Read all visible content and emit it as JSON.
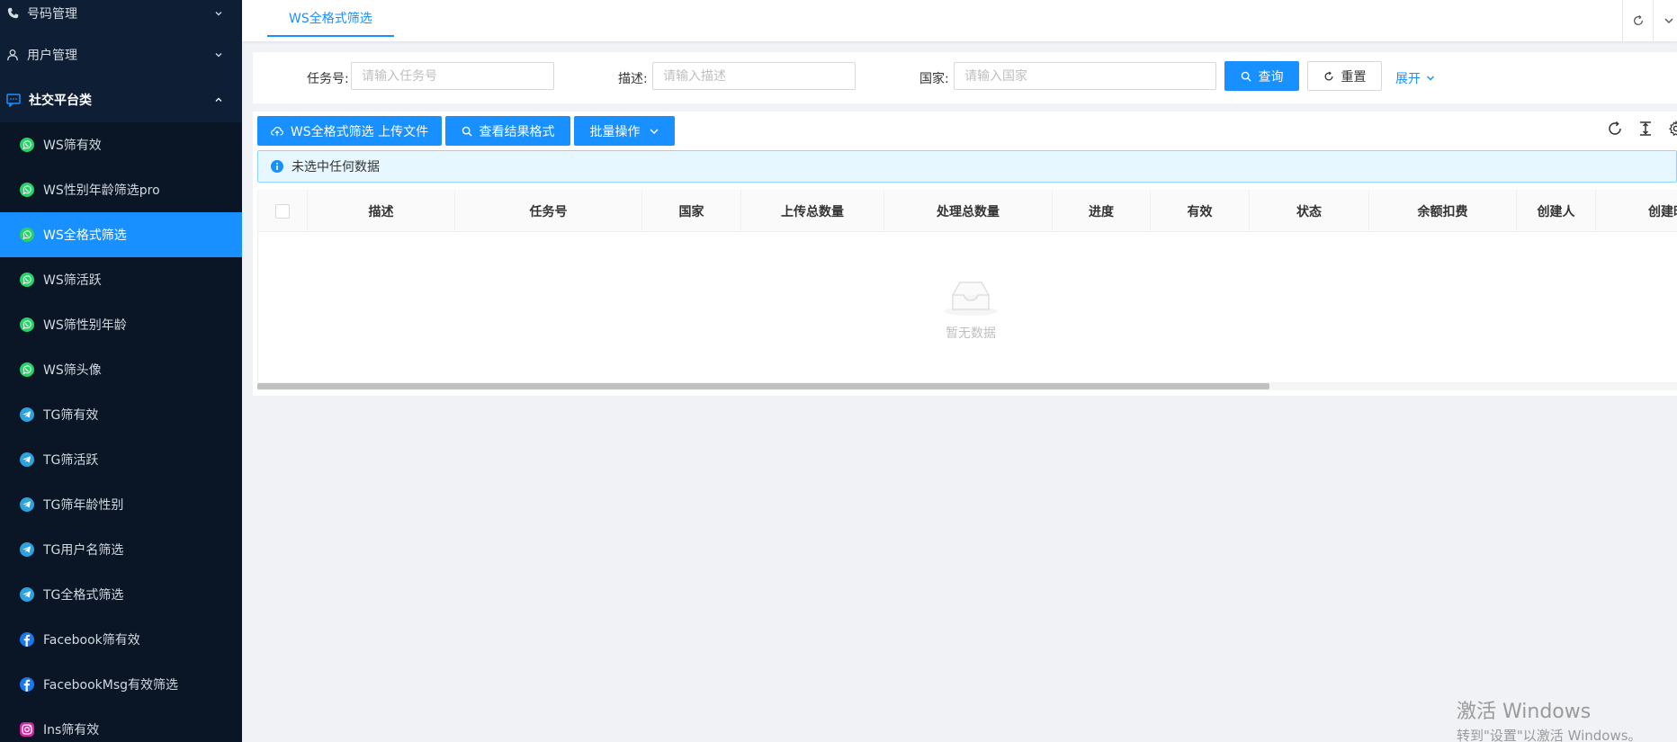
{
  "sidebar": {
    "groups": [
      {
        "label": "号码管理",
        "icon": "phone-icon"
      },
      {
        "label": "用户管理",
        "icon": "user-icon"
      },
      {
        "label": "社交平台类",
        "icon": "chat-icon"
      }
    ],
    "items": [
      {
        "label": "WS筛有效",
        "icon": "whatsapp-icon"
      },
      {
        "label": "WS性别年龄筛选pro",
        "icon": "whatsapp-icon"
      },
      {
        "label": "WS全格式筛选",
        "icon": "whatsapp-icon",
        "active": true
      },
      {
        "label": "WS筛活跃",
        "icon": "whatsapp-icon"
      },
      {
        "label": "WS筛性别年龄",
        "icon": "whatsapp-icon"
      },
      {
        "label": "WS筛头像",
        "icon": "whatsapp-icon"
      },
      {
        "label": "TG筛有效",
        "icon": "telegram-icon"
      },
      {
        "label": "TG筛活跃",
        "icon": "telegram-icon"
      },
      {
        "label": "TG筛年龄性别",
        "icon": "telegram-icon"
      },
      {
        "label": "TG用户名筛选",
        "icon": "telegram-icon"
      },
      {
        "label": "TG全格式筛选",
        "icon": "telegram-icon"
      },
      {
        "label": "Facebook筛有效",
        "icon": "facebook-icon"
      },
      {
        "label": "FacebookMsg有效筛选",
        "icon": "facebook-icon"
      },
      {
        "label": "Ins筛有效",
        "icon": "instagram-icon"
      }
    ]
  },
  "tabs": [
    {
      "label": "WS全格式筛选"
    }
  ],
  "search": {
    "task_label": "任务号:",
    "task_placeholder": "请输入任务号",
    "desc_label": "描述:",
    "desc_placeholder": "请输入描述",
    "country_label": "国家:",
    "country_placeholder": "请输入国家",
    "query_label": "查询",
    "reset_label": "重置",
    "expand_label": "展开"
  },
  "toolbar": {
    "upload_label": "WS全格式筛选 上传文件",
    "view_format_label": "查看结果格式",
    "batch_label": "批量操作"
  },
  "alert": {
    "text": "未选中任何数据"
  },
  "table": {
    "columns": [
      "描述",
      "任务号",
      "国家",
      "上传总数量",
      "处理总数量",
      "进度",
      "有效",
      "状态",
      "余额扣费",
      "创建人",
      "创建时"
    ],
    "empty_text": "暂无数据"
  },
  "watermark": {
    "line1": "激活 Windows",
    "line2": "转到\"设置\"以激活 Windows。"
  },
  "colors": {
    "primary": "#1890ff",
    "sidebar_bg": "#0e1f35",
    "whatsapp": "#25d366",
    "telegram": "#2aa3df",
    "facebook": "#1877f2"
  }
}
